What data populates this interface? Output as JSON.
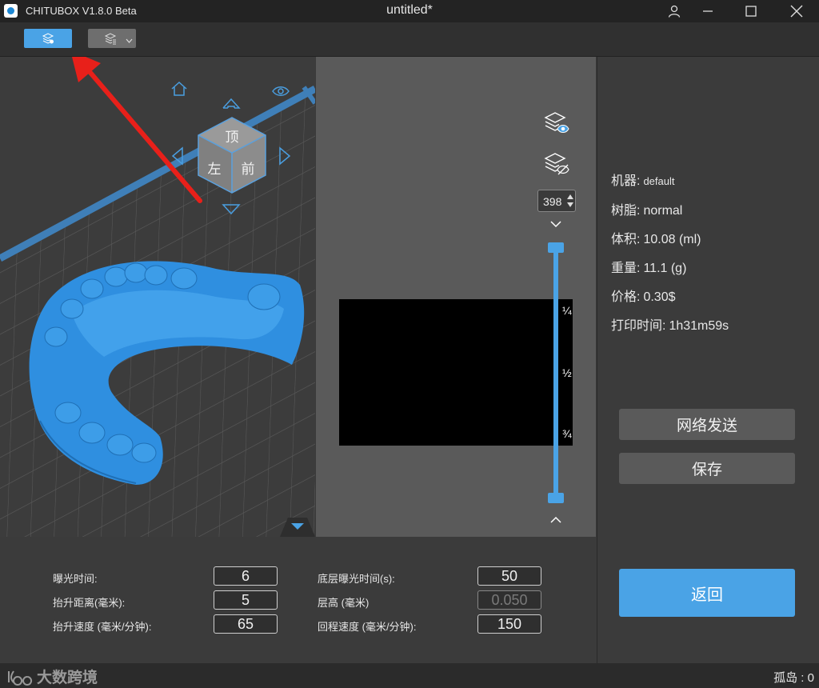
{
  "titlebar": {
    "app_name": "CHITUBOX V1.8.0 Beta",
    "document_title": "untitled*"
  },
  "view_cube": {
    "top": "顶",
    "left": "左",
    "front": "前"
  },
  "preview": {
    "layer_number": "398",
    "ticks": [
      "¼",
      "½",
      "¾"
    ]
  },
  "info": {
    "machine_label": "机器:",
    "machine_value": "default",
    "resin_label": "树脂:",
    "resin_value": "normal",
    "volume_label": "体积:",
    "volume_value": "10.08  (ml)",
    "weight_label": "重量:",
    "weight_value": "11.1  (g)",
    "price_label": "价格:",
    "price_value": "0.30$",
    "print_time_label": "打印时间:",
    "print_time_value": "1h31m59s"
  },
  "actions": {
    "network_send": "网络发送",
    "save": "保存",
    "back": "返回"
  },
  "params": {
    "exposure_time_label": "曝光时间:",
    "exposure_time": "6",
    "lift_distance_label": "抬升距离(毫米):",
    "lift_distance": "5",
    "lift_speed_label": "抬升速度 (毫米/分钟):",
    "lift_speed": "65",
    "bottom_exposure_label": "底层曝光时间(s):",
    "bottom_exposure": "50",
    "layer_height_label": "层高 (毫米)",
    "layer_height": "0.050",
    "retract_speed_label": "回程速度 (毫米/分钟):",
    "retract_speed": "150"
  },
  "status": {
    "watermark": "大数跨境",
    "island_count": "孤岛 : 0"
  },
  "colors": {
    "accent": "#4aa3e6",
    "model": "#2f8fe0",
    "annotation_arrow": "#e8201a"
  }
}
